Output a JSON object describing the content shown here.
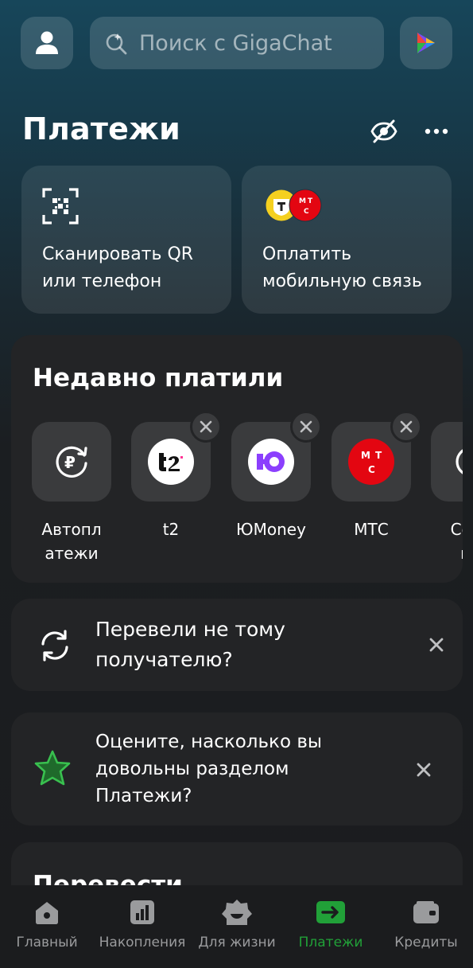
{
  "header": {
    "search_placeholder": "Поиск с GigaChat"
  },
  "page": {
    "title": "Платежи"
  },
  "quick_actions": [
    {
      "label_line1": "Сканировать QR",
      "label_line2": "или телефон",
      "icon": "qr-scan-icon"
    },
    {
      "label_line1": "Оплатить",
      "label_line2": "мобильную связь",
      "icon": "mobile-operators-icon"
    }
  ],
  "recent": {
    "title": "Недавно платили",
    "items": [
      {
        "label_line1": "Автопл",
        "label_line2": "атежи",
        "icon": "autopay-icon",
        "removable": false
      },
      {
        "label_line1": "t2",
        "label_line2": "",
        "icon": "t2-logo",
        "removable": true
      },
      {
        "label_line1": "ЮMoney",
        "label_line2": "",
        "icon": "yoomoney-logo",
        "removable": true
      },
      {
        "label_line1": "МТС",
        "label_line2": "",
        "icon": "mts-logo",
        "removable": true
      },
      {
        "label_line1": "Сохр",
        "label_line2": "пл",
        "icon": "saved-payments-icon",
        "removable": false
      }
    ]
  },
  "wrong_recipient": {
    "line1": "Перевели не тому",
    "line2": "получателю?"
  },
  "feedback": {
    "line1": "Оцените, насколько вы",
    "line2": "довольны разделом",
    "line3": "Платежи?"
  },
  "transfer": {
    "title": "Перевести"
  },
  "nav": {
    "items": [
      {
        "label": "Главный",
        "icon": "home-icon"
      },
      {
        "label": "Накопления",
        "icon": "savings-icon"
      },
      {
        "label": "Для жизни",
        "icon": "lifestyle-icon"
      },
      {
        "label": "Платежи",
        "icon": "payments-icon",
        "active": true
      },
      {
        "label": "Кредиты",
        "icon": "credits-icon"
      }
    ]
  },
  "colors": {
    "accent_green": "#21a038",
    "mts_red": "#e30611",
    "yoomoney_purple": "#8b3ffd"
  }
}
